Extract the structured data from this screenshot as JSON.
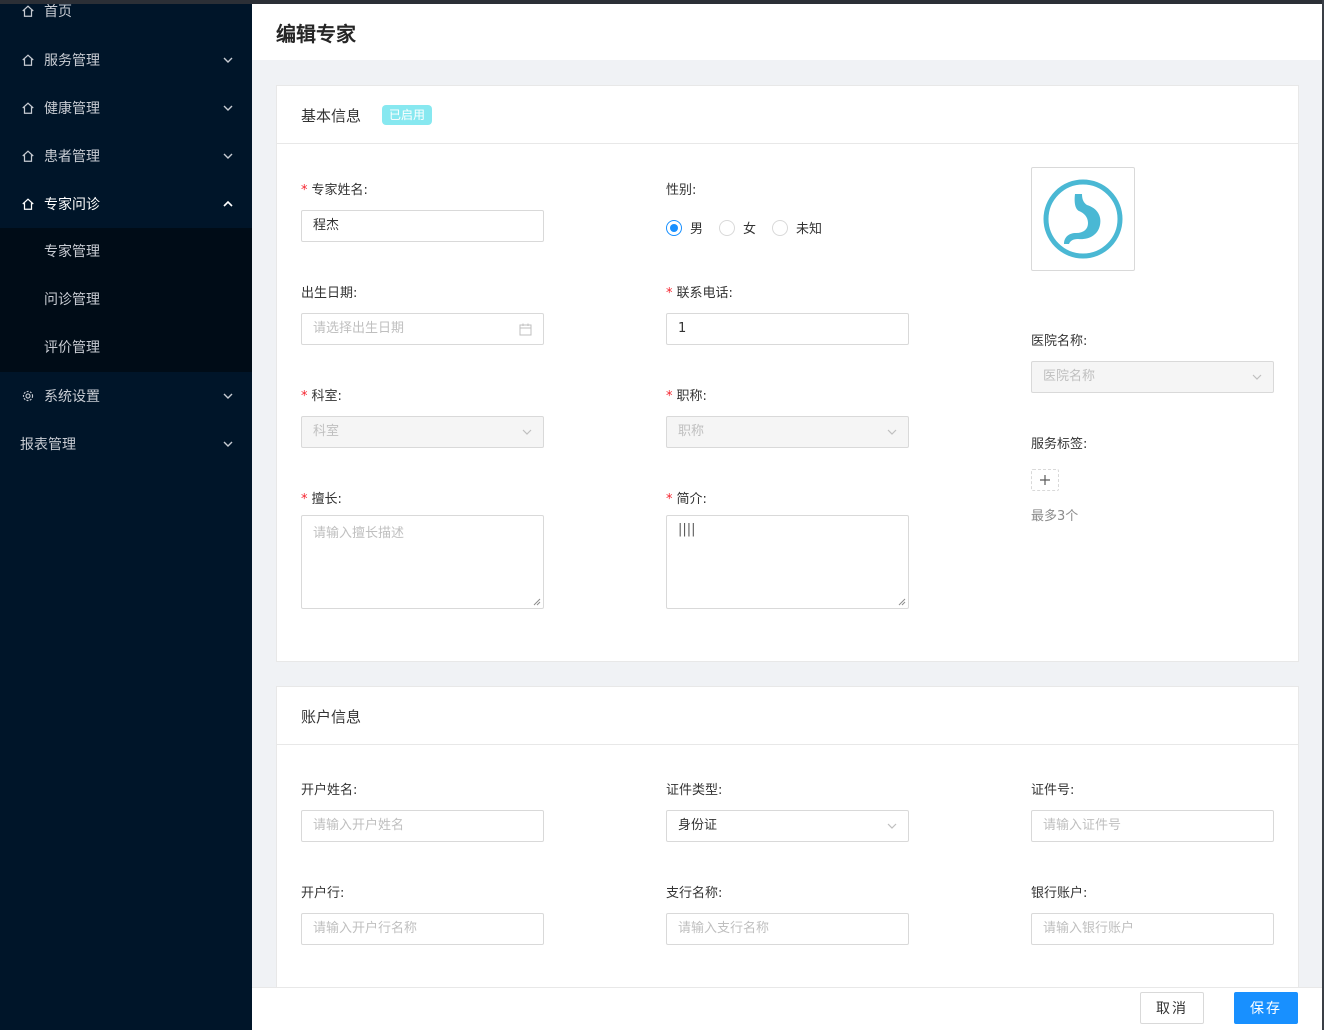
{
  "sidebar": {
    "items": [
      {
        "label": "首页",
        "icon": "home-icon"
      },
      {
        "label": "服务管理",
        "icon": "home-icon"
      },
      {
        "label": "健康管理",
        "icon": "home-icon"
      },
      {
        "label": "患者管理",
        "icon": "home-icon"
      },
      {
        "label": "专家问诊",
        "icon": "home-icon"
      },
      {
        "label": "系统设置",
        "icon": "gear-icon"
      },
      {
        "label": "报表管理",
        "icon": ""
      }
    ],
    "submenu": [
      "专家管理",
      "问诊管理",
      "评价管理"
    ]
  },
  "header": {
    "title": "编辑专家"
  },
  "basic": {
    "title": "基本信息",
    "status_tag": "已启用",
    "name_label": "专家姓名:",
    "name_value": "程杰",
    "gender_label": "性别:",
    "gender_options": [
      "男",
      "女",
      "未知"
    ],
    "gender_selected": "男",
    "birth_label": "出生日期:",
    "birth_placeholder": "请选择出生日期",
    "phone_label": "联系电话:",
    "phone_value": "1",
    "dept_label": "科室:",
    "dept_placeholder": "科室",
    "rank_label": "职称:",
    "rank_placeholder": "职称",
    "skill_label": "擅长:",
    "skill_placeholder": "请输入擅长描述",
    "intro_label": "简介:",
    "intro_value": "||||",
    "hospital_label": "医院名称:",
    "hospital_placeholder": "医院名称",
    "tags_label": "服务标签:",
    "tags_hint": "最多3个",
    "avatar_icon": "stomach-icon",
    "avatar_color": "#4ab8d4"
  },
  "account": {
    "title": "账户信息",
    "holder_label": "开户姓名:",
    "holder_placeholder": "请输入开户姓名",
    "idtype_label": "证件类型:",
    "idtype_value": "身份证",
    "idno_label": "证件号:",
    "idno_placeholder": "请输入证件号",
    "bank_label": "开户行:",
    "bank_placeholder": "请输入开户行名称",
    "branch_label": "支行名称:",
    "branch_placeholder": "请输入支行名称",
    "acct_label": "银行账户:",
    "acct_placeholder": "请输入银行账户"
  },
  "footer": {
    "cancel_label": "取消",
    "save_label": "保存"
  },
  "colors": {
    "sidebar_bg": "#001529",
    "primary": "#1890ff",
    "required": "#f5222d",
    "tag_bg": "#87e8f0"
  }
}
